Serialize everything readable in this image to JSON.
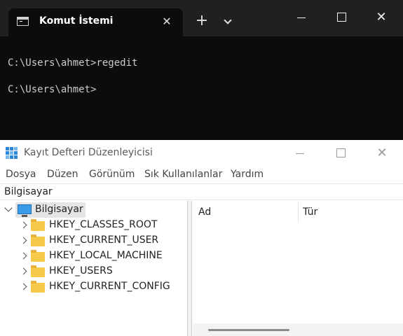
{
  "terminal": {
    "tab_title": "Komut İstemi",
    "icons": {
      "tab": "cmd-icon",
      "close_tab": "close-icon",
      "new_tab": "plus-icon",
      "dropdown": "chevron-down-icon"
    },
    "lines": [
      "C:\\Users\\ahmet>regedit",
      "C:\\Users\\ahmet>"
    ],
    "close_glyph": "✕",
    "new_tab_glyph": "+",
    "window_close_glyph": "✕"
  },
  "regedit": {
    "title": "Kayıt Defteri Düzenleyicisi",
    "close_glyph": "✕",
    "menu": [
      "Dosya",
      "Düzen",
      "Görünüm",
      "Sık Kullanılanlar",
      "Yardım"
    ],
    "address": "Bilgisayar",
    "tree": {
      "root": "Bilgisayar",
      "children": [
        "HKEY_CLASSES_ROOT",
        "HKEY_CURRENT_USER",
        "HKEY_LOCAL_MACHINE",
        "HKEY_USERS",
        "HKEY_CURRENT_CONFIG"
      ]
    },
    "columns": [
      "Ad",
      "Tür"
    ]
  },
  "colors": {
    "terminal_bg": "#0c0c0c",
    "terminal_titlebar": "#202020",
    "selection_bg": "#e5e5e5",
    "folder": "#f7c948",
    "accent": "#2b88d8"
  }
}
